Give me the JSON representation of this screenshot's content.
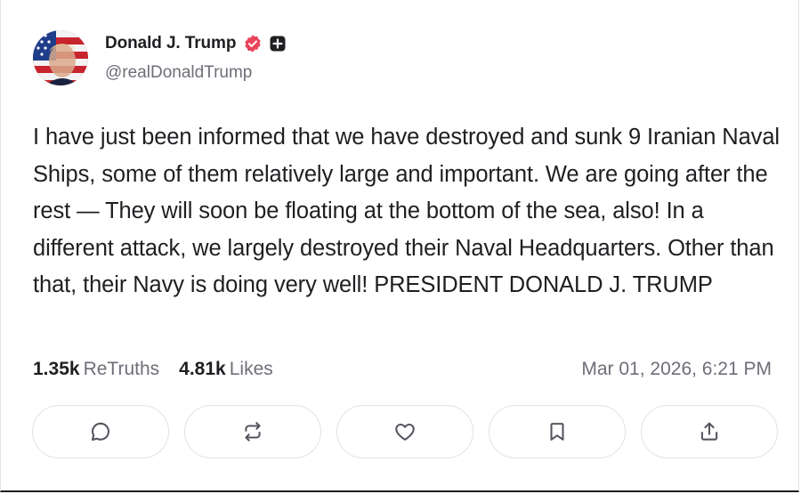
{
  "post": {
    "author": {
      "display_name": "Donald J. Trump",
      "handle": "@realDonaldTrump",
      "verified_icon": "verified-badge-icon",
      "plus_icon": "plus-badge-icon",
      "accent_color": "#e8445a"
    },
    "text": "I have just been informed that we have destroyed and sunk 9 Iranian Naval Ships, some of them relatively large and important. We are going after the rest — They will soon be floating at the bottom of the sea, also! In a different attack, we largely destroyed their Naval Headquarters. Other than that, their Navy is doing very well! PRESIDENT DONALD J. TRUMP",
    "stats": {
      "retruths_count": "1.35k",
      "retruths_label": "ReTruths",
      "likes_count": "4.81k",
      "likes_label": "Likes"
    },
    "timestamp": "Mar 01, 2026, 6:21 PM"
  },
  "actions": [
    {
      "name": "reply",
      "icon": "comment-icon"
    },
    {
      "name": "retruth",
      "icon": "repost-icon"
    },
    {
      "name": "like",
      "icon": "heart-icon"
    },
    {
      "name": "bookmark",
      "icon": "bookmark-icon"
    },
    {
      "name": "share",
      "icon": "share-icon"
    }
  ]
}
